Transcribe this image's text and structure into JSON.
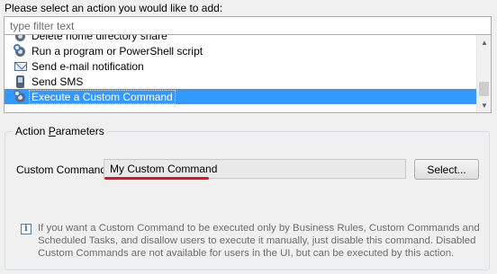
{
  "prompt": "Please select an action you would like to add:",
  "filter": {
    "value": "",
    "placeholder": "type filter text"
  },
  "actions_list": {
    "items": [
      {
        "label": "Delete home directory share",
        "icon": "gear-icon"
      },
      {
        "label": "Run a program or PowerShell script",
        "icon": "gear-icon"
      },
      {
        "label": "Send e-mail notification",
        "icon": "envelope-icon"
      },
      {
        "label": "Send SMS",
        "icon": "mobile-phone-icon"
      },
      {
        "label": "Execute a Custom Command",
        "icon": "gear-icon",
        "selected": true
      }
    ]
  },
  "action_parameters": {
    "title_prefix": "Action ",
    "title_accel": "P",
    "title_suffix": "arameters",
    "custom_command_label": "Custom Command:",
    "custom_command_value": "My Custom Command",
    "select_button": "Select...",
    "info_text": "If you want a Custom Command to be executed only by Business Rules, Custom Commands and Scheduled Tasks, and disallow users to execute it manually, just disable this command. Disabled Custom Commands are not available for users in the UI, but can be executed by this action."
  },
  "colors": {
    "selection": "#3399ff",
    "highlight_underline": "#e8111e"
  }
}
